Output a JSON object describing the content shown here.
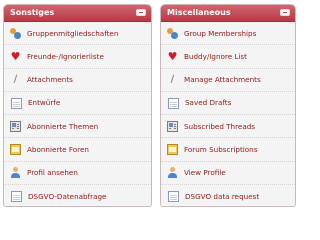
{
  "panels": [
    {
      "title": "Sonstiges",
      "items": [
        {
          "label": "Gruppenmitgliedschaften",
          "icon": "group-icon"
        },
        {
          "label": "Freunde-/Ignorierliste",
          "icon": "heart-icon"
        },
        {
          "label": "Attachments",
          "icon": "paperclip-icon"
        },
        {
          "label": "Entwürfe",
          "icon": "document-icon"
        },
        {
          "label": "Abonnierte Themen",
          "icon": "newspaper-icon"
        },
        {
          "label": "Abonnierte Foren",
          "icon": "forum-icon"
        },
        {
          "label": "Profil ansehen",
          "icon": "person-icon"
        },
        {
          "label": "DSGVO-Datenabfrage",
          "icon": "document-icon"
        }
      ]
    },
    {
      "title": "Miscellaneous",
      "items": [
        {
          "label": "Group Memberships",
          "icon": "group-icon"
        },
        {
          "label": "Buddy/Ignore List",
          "icon": "heart-icon"
        },
        {
          "label": "Manage Attachments",
          "icon": "paperclip-icon"
        },
        {
          "label": "Saved Drafts",
          "icon": "document-icon"
        },
        {
          "label": "Subscribed Threads",
          "icon": "newspaper-icon"
        },
        {
          "label": "Forum Subscriptions",
          "icon": "forum-icon"
        },
        {
          "label": "View Profile",
          "icon": "person-icon"
        },
        {
          "label": "DSGVO data request",
          "icon": "document-icon"
        }
      ]
    }
  ],
  "colors": {
    "header_start": "#d2656f",
    "header_end": "#b53a45",
    "link": "#8b1a1a",
    "panel_bg": "#f4f4f4"
  }
}
